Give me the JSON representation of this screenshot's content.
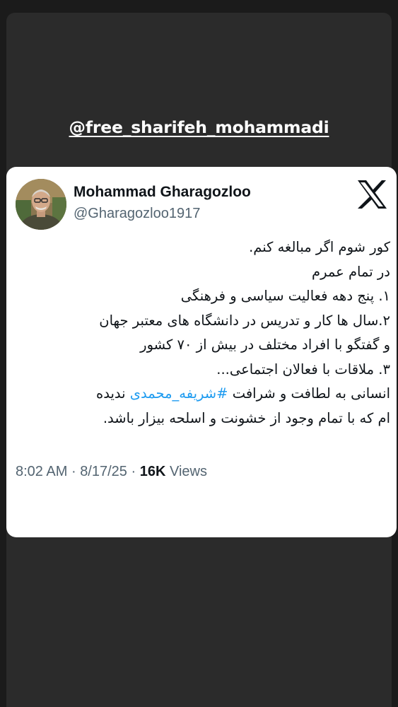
{
  "story": {
    "handle": "@free_sharifeh_mohammadi"
  },
  "tweet": {
    "display_name": "Mohammad Gharagozloo",
    "username": "@Gharagozloo1917",
    "logo_icon": "x-logo-icon",
    "lines": [
      "کور شوم اگر مبالغه کنم.",
      "در تمام عمرم",
      "۱. پنج دهه فعالیت سیاسی و فرهنگی",
      "۲.سال ها کار و تدریس در دانشگاه های معتبر جهان",
      "و گفتگو با افراد مختلف در بیش از ۷۰ کشور",
      "۳. ملاقات با فعالان اجتماعی...",
      "انسانی به لطافت و شرافت",
      "ام که با تمام وجود از خشونت و اسلحه بیزار باشد."
    ],
    "hashtag": "#شریفه_محمدی",
    "line7_end": "ندیده",
    "time": "8:02 AM",
    "separator": "·",
    "date": "8/17/25",
    "views_count": "16K",
    "views_label": "Views"
  },
  "colors": {
    "background": "#1b1b1b",
    "panel": "#2b2b2b",
    "card": "#ffffff",
    "text": "#0f1419",
    "secondary": "#536471",
    "hashtag": "#1d9bf0"
  }
}
